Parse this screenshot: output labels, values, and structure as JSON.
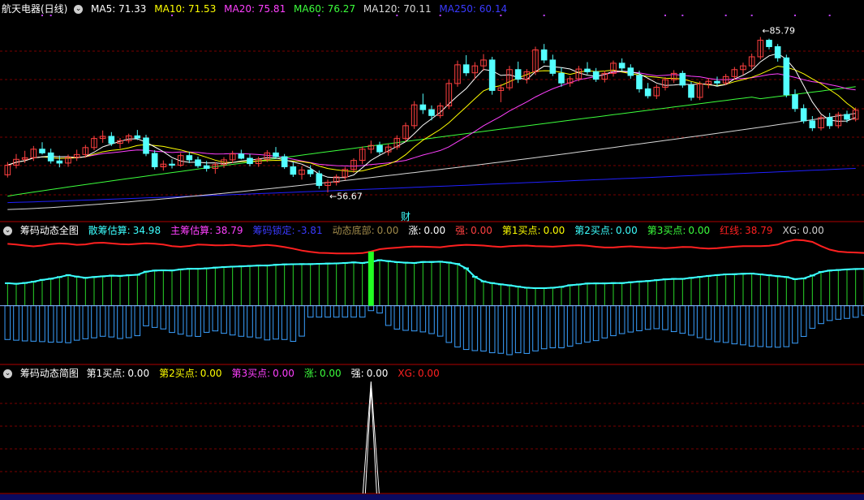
{
  "colors": {
    "bg": "#000000",
    "up": "#ff4040",
    "down": "#54ffff",
    "ma5": "#ffffff",
    "ma10": "#ffff00",
    "ma20": "#ff40ff",
    "ma60": "#3cff3c",
    "ma120": "#d8d8d8",
    "ma250": "#2020ff",
    "grid": "#7a0000",
    "red_line": "#ff2020",
    "cyan_line": "#3cffff",
    "blue_bar": "#3aa0ff",
    "green_bar": "#29d629",
    "white_spike": "#ffffff"
  },
  "panel1": {
    "title": "航天电器(日线)",
    "ma5": "MA5: 71.33",
    "ma10": "MA10: 71.53",
    "ma20": "MA20: 75.81",
    "ma60": "MA60: 76.27",
    "ma120": "MA120: 70.11",
    "ma250": "MA250: 60.14",
    "high_label": "85.79",
    "low_label": "56.67",
    "cai_label": "财"
  },
  "panel2": {
    "title": "筹码动态全图",
    "items": [
      {
        "k": "散筹估算:",
        "v": "34.98",
        "kc": "#3cffff",
        "vc": "#3cffff"
      },
      {
        "k": "主筹估算:",
        "v": "38.79",
        "kc": "#ff40ff",
        "vc": "#ff40ff"
      },
      {
        "k": "筹码锁定:",
        "v": "-3.81",
        "kc": "#3a3aff",
        "vc": "#3a3aff"
      },
      {
        "k": "动态底部:",
        "v": "0.00",
        "kc": "#a08a4a",
        "vc": "#a08a4a"
      },
      {
        "k": "涨:",
        "v": "0.00",
        "kc": "#ffffff",
        "vc": "#ffffff"
      },
      {
        "k": "强:",
        "v": "0.00",
        "kc": "#ff4040",
        "vc": "#ff4040"
      },
      {
        "k": "第1买点:",
        "v": "0.00",
        "kc": "#ffff00",
        "vc": "#ffff00"
      },
      {
        "k": "第2买点:",
        "v": "0.00",
        "kc": "#3cffff",
        "vc": "#3cffff"
      },
      {
        "k": "第3买点:",
        "v": "0.00",
        "kc": "#3cff3c",
        "vc": "#3cff3c"
      },
      {
        "k": "红线:",
        "v": "38.79",
        "kc": "#ff2020",
        "vc": "#ff2020"
      },
      {
        "k": "XG:",
        "v": "0.00",
        "kc": "#cfcfcf",
        "vc": "#cfcfcf"
      }
    ]
  },
  "panel3": {
    "title": "筹码动态简图",
    "items": [
      {
        "k": "第1买点:",
        "v": "0.00",
        "kc": "#ffffff",
        "vc": "#ffffff"
      },
      {
        "k": "第2买点:",
        "v": "0.00",
        "kc": "#ffff00",
        "vc": "#ffff00"
      },
      {
        "k": "第3买点:",
        "v": "0.00",
        "kc": "#ff40ff",
        "vc": "#ff40ff"
      },
      {
        "k": "涨:",
        "v": "0.00",
        "kc": "#3cff3c",
        "vc": "#3cff3c"
      },
      {
        "k": "强:",
        "v": "0.00",
        "kc": "#ffffff",
        "vc": "#ffffff"
      },
      {
        "k": "XG:",
        "v": "0.00",
        "kc": "#ff2020",
        "vc": "#ff2020"
      }
    ]
  },
  "chart_data": {
    "type": "line",
    "title": "航天电器(日线)",
    "price_range": [
      52,
      90
    ],
    "candles_ohlc": [
      [
        60.0,
        62.4,
        59.5,
        61.8
      ],
      [
        61.8,
        63.9,
        61.2,
        62.9
      ],
      [
        62.9,
        64.5,
        62.2,
        63.2
      ],
      [
        63.2,
        65.4,
        62.6,
        64.8
      ],
      [
        64.8,
        66.1,
        63.8,
        64.1
      ],
      [
        64.1,
        64.9,
        62.1,
        62.6
      ],
      [
        62.6,
        63.6,
        61.4,
        62.2
      ],
      [
        62.2,
        63.8,
        61.5,
        63.3
      ],
      [
        63.3,
        64.7,
        62.6,
        63.8
      ],
      [
        63.8,
        65.6,
        63.2,
        65.1
      ],
      [
        65.1,
        67.3,
        64.6,
        66.8
      ],
      [
        66.8,
        68.3,
        66.0,
        67.2
      ],
      [
        67.2,
        68.0,
        65.4,
        65.9
      ],
      [
        65.9,
        66.9,
        64.9,
        66.4
      ],
      [
        66.4,
        67.7,
        65.9,
        67.3
      ],
      [
        67.3,
        68.4,
        66.5,
        66.9
      ],
      [
        66.9,
        67.5,
        63.5,
        64.0
      ],
      [
        64.0,
        64.6,
        61.0,
        61.5
      ],
      [
        61.5,
        62.7,
        60.8,
        62.0
      ],
      [
        62.0,
        62.9,
        61.2,
        61.8
      ],
      [
        61.8,
        64.1,
        61.5,
        63.6
      ],
      [
        63.6,
        64.3,
        62.2,
        62.8
      ],
      [
        62.8,
        63.4,
        61.3,
        61.7
      ],
      [
        61.7,
        62.6,
        60.6,
        61.2
      ],
      [
        61.2,
        62.4,
        60.2,
        61.9
      ],
      [
        61.9,
        63.3,
        61.3,
        62.8
      ],
      [
        62.8,
        64.5,
        62.2,
        63.9
      ],
      [
        63.9,
        64.7,
        62.9,
        63.1
      ],
      [
        63.1,
        63.9,
        61.6,
        62.1
      ],
      [
        62.1,
        63.4,
        61.5,
        62.9
      ],
      [
        62.9,
        64.6,
        62.4,
        64.1
      ],
      [
        64.1,
        65.2,
        63.0,
        63.4
      ],
      [
        63.4,
        63.9,
        61.1,
        61.5
      ],
      [
        61.5,
        62.3,
        59.6,
        60.1
      ],
      [
        60.1,
        61.6,
        59.1,
        60.9
      ],
      [
        60.9,
        61.8,
        59.6,
        60.2
      ],
      [
        60.2,
        60.8,
        57.4,
        58.0
      ],
      [
        58.0,
        59.1,
        56.7,
        58.6
      ],
      [
        58.6,
        60.1,
        58.0,
        59.6
      ],
      [
        59.6,
        61.5,
        59.0,
        61.0
      ],
      [
        61.0,
        63.1,
        60.4,
        62.7
      ],
      [
        62.7,
        65.3,
        62.0,
        64.8
      ],
      [
        64.8,
        66.4,
        64.0,
        65.5
      ],
      [
        65.5,
        66.2,
        63.8,
        64.3
      ],
      [
        64.3,
        65.8,
        63.6,
        65.2
      ],
      [
        65.2,
        67.4,
        64.7,
        66.8
      ],
      [
        66.8,
        69.8,
        66.2,
        69.2
      ],
      [
        69.2,
        73.8,
        68.6,
        73.1
      ],
      [
        73.1,
        75.2,
        71.4,
        72.2
      ],
      [
        72.2,
        73.0,
        70.2,
        71.1
      ],
      [
        71.1,
        73.5,
        70.6,
        72.9
      ],
      [
        72.9,
        77.8,
        72.4,
        77.1
      ],
      [
        77.1,
        81.4,
        76.5,
        80.6
      ],
      [
        80.6,
        82.4,
        78.5,
        79.1
      ],
      [
        79.1,
        81.1,
        77.9,
        80.4
      ],
      [
        80.4,
        82.6,
        79.5,
        81.5
      ],
      [
        81.5,
        82.1,
        75.0,
        75.8
      ],
      [
        75.8,
        77.0,
        73.6,
        76.3
      ],
      [
        76.3,
        80.4,
        75.8,
        79.7
      ],
      [
        79.7,
        81.2,
        77.2,
        77.9
      ],
      [
        77.9,
        79.8,
        77.1,
        79.3
      ],
      [
        79.3,
        84.0,
        78.7,
        83.4
      ],
      [
        83.4,
        84.5,
        80.9,
        81.5
      ],
      [
        81.5,
        82.5,
        78.5,
        79.0
      ],
      [
        79.0,
        80.1,
        76.5,
        77.2
      ],
      [
        77.2,
        78.5,
        76.5,
        78.0
      ],
      [
        78.0,
        80.4,
        77.5,
        79.8
      ],
      [
        79.8,
        81.1,
        78.8,
        79.3
      ],
      [
        79.3,
        80.0,
        77.4,
        77.9
      ],
      [
        77.9,
        79.5,
        77.3,
        79.0
      ],
      [
        79.0,
        81.4,
        78.4,
        80.9
      ],
      [
        80.9,
        81.8,
        79.4,
        80.0
      ],
      [
        80.0,
        80.7,
        78.0,
        78.6
      ],
      [
        78.6,
        79.5,
        75.4,
        76.1
      ],
      [
        76.1,
        77.2,
        74.3,
        74.8
      ],
      [
        74.8,
        76.9,
        74.2,
        76.4
      ],
      [
        76.4,
        78.3,
        75.8,
        77.8
      ],
      [
        77.8,
        79.6,
        77.2,
        79.0
      ],
      [
        79.0,
        79.5,
        76.3,
        76.8
      ],
      [
        76.8,
        77.4,
        73.9,
        74.5
      ],
      [
        74.5,
        77.5,
        74.0,
        77.0
      ],
      [
        77.0,
        78.1,
        76.2,
        77.5
      ],
      [
        77.5,
        78.4,
        76.6,
        77.2
      ],
      [
        77.2,
        78.9,
        76.8,
        78.4
      ],
      [
        78.4,
        80.2,
        77.8,
        79.7
      ],
      [
        79.7,
        81.0,
        78.7,
        80.4
      ],
      [
        80.4,
        82.7,
        79.8,
        82.1
      ],
      [
        82.1,
        85.8,
        81.6,
        85.2
      ],
      [
        85.2,
        85.5,
        83.5,
        84.0
      ],
      [
        84.0,
        84.5,
        81.2,
        81.9
      ],
      [
        81.9,
        82.5,
        74.5,
        75.0
      ],
      [
        75.0,
        76.0,
        71.8,
        72.4
      ],
      [
        72.4,
        73.2,
        69.6,
        70.1
      ],
      [
        70.1,
        71.0,
        68.2,
        68.8
      ],
      [
        68.8,
        71.2,
        68.3,
        70.7
      ],
      [
        70.7,
        71.6,
        68.6,
        69.2
      ],
      [
        69.2,
        71.8,
        68.7,
        71.3
      ],
      [
        71.3,
        72.0,
        69.8,
        70.4
      ],
      [
        70.4,
        72.6,
        70.0,
        72.1
      ]
    ],
    "ma_series": [
      {
        "name": "MA5",
        "last": 71.33
      },
      {
        "name": "MA10",
        "last": 71.53
      },
      {
        "name": "MA20",
        "last": 75.81
      },
      {
        "name": "MA60",
        "last": 76.27
      },
      {
        "name": "MA120",
        "last": 70.11
      },
      {
        "name": "MA250",
        "last": 60.14
      }
    ],
    "annotations": [
      {
        "text": "85.79",
        "candle": 87,
        "price": 85.79
      },
      {
        "text": "56.67",
        "candle": 37,
        "price": 56.67
      },
      {
        "text": "财",
        "candle": 46,
        "price": null
      }
    ],
    "indicator_range": [
      -40,
      50
    ],
    "red_line": [
      44,
      43.5,
      42.8,
      42.2,
      42.8,
      43.8,
      44.3,
      44.0,
      43.3,
      43.6,
      44.6,
      44.8,
      44.3,
      43.8,
      43.6,
      44.0,
      44.4,
      44.1,
      43.5,
      42.4,
      41.9,
      42.5,
      43.5,
      43.3,
      42.9,
      43.0,
      43.3,
      42.6,
      42.2,
      42.8,
      43.2,
      42.6,
      41.7,
      40.6,
      39.2,
      38.3,
      37.6,
      37.4,
      37.2,
      37.2,
      37.2,
      37.4,
      38.5,
      40.2,
      40.8,
      41.3,
      41.8,
      42.1,
      42.0,
      41.8,
      41.6,
      42.3,
      42.9,
      43.3,
      43.1,
      42.8,
      42.2,
      41.8,
      42.3,
      42.6,
      42.8,
      42.4,
      42.2,
      42.0,
      42.4,
      42.8,
      43.0,
      42.6,
      41.9,
      41.4,
      41.4,
      41.9,
      42.2,
      41.8,
      41.5,
      41.2,
      40.9,
      41.3,
      41.8,
      41.7,
      41.0,
      40.6,
      40.9,
      41.5,
      42.0,
      42.3,
      42.4,
      42.3,
      42.6,
      43.5,
      45.6,
      46.8,
      46.5,
      45.4,
      42.4,
      39.9,
      38.5,
      38.0,
      37.8,
      37.5,
      37.6,
      37.9,
      38.3,
      38.8,
      38.5
    ],
    "cyan_line": [
      16,
      15.6,
      16.2,
      17.1,
      18.4,
      19.2,
      20.4,
      21.8,
      20.7,
      19.8,
      20.4,
      20.9,
      21.4,
      21.2,
      21.7,
      22.0,
      24.2,
      25.0,
      25.2,
      25.1,
      25.8,
      26.3,
      26.3,
      26.6,
      27.1,
      27.5,
      27.8,
      28.0,
      28.3,
      28.6,
      28.6,
      29.1,
      29.4,
      29.5,
      29.6,
      29.6,
      29.8,
      30.0,
      30.1,
      30.4,
      30.8,
      30.4,
      31.2,
      32.4,
      31.7,
      31.0,
      30.6,
      30.4,
      31.1,
      31.1,
      31.3,
      30.7,
      29.7,
      26.6,
      20.6,
      17.3,
      16.1,
      15.2,
      14.5,
      13.6,
      12.8,
      12.5,
      12.5,
      12.8,
      13.4,
      14.6,
      15.1,
      15.8,
      15.9,
      15.9,
      16.1,
      16.1,
      16.7,
      17.2,
      17.6,
      18.2,
      18.8,
      19.1,
      19.1,
      19.8,
      20.5,
      21.2,
      21.8,
      22.3,
      22.4,
      22.7,
      22.9,
      22.3,
      21.7,
      21.0,
      20.4,
      18.9,
      19.4,
      21.5,
      24.0,
      25.0,
      25.4,
      25.8,
      26.1,
      26.2,
      26.4,
      26.8,
      27.2,
      27.7,
      28.1
    ],
    "blue_bars": [
      -24,
      -24.5,
      -25,
      -25.2,
      -25.5,
      -25.9,
      -25.9,
      -26.3,
      -24.5,
      -23.5,
      -22.8,
      -21.7,
      -22.2,
      -23.3,
      -22.7,
      -21.3,
      -14.3,
      -15.4,
      -16.5,
      -19,
      -20.2,
      -21.5,
      -21.8,
      -18.9,
      -17.9,
      -19.6,
      -20.8,
      -21.7,
      -22.2,
      -22.8,
      -24.3,
      -23.7,
      -24,
      -25.3,
      -21.6,
      -8.1,
      -8.1,
      -8.1,
      -8.1,
      -8.1,
      -8.1,
      -8.1,
      -3.5,
      -5.2,
      -14,
      -16.6,
      -17.5,
      -17.9,
      -18.6,
      -19.8,
      -21.6,
      -26.1,
      -29.3,
      -31.1,
      -31.9,
      -32.2,
      -33.4,
      -33.8,
      -34.8,
      -33.4,
      -33.9,
      -32.1,
      -30.6,
      -29.9,
      -29.9,
      -28.7,
      -26.9,
      -25.8,
      -24.8,
      -22.9,
      -21.3,
      -19.8,
      -18.7,
      -17.8,
      -16.8,
      -16.3,
      -17,
      -18.4,
      -19.6,
      -20.9,
      -22.7,
      -23.9,
      -25.6,
      -26.1,
      -27.1,
      -27.8,
      -28.7,
      -29,
      -29.3,
      -29.5,
      -29.1,
      -26.6,
      -21.8,
      -16,
      -12.7,
      -10.5,
      -9.6,
      -9,
      -8.2,
      -6.7,
      -5.7,
      -4.6,
      -4,
      -3.1,
      -2.4
    ],
    "green_marker_candle": 42,
    "signal_spike_candle": 42
  }
}
